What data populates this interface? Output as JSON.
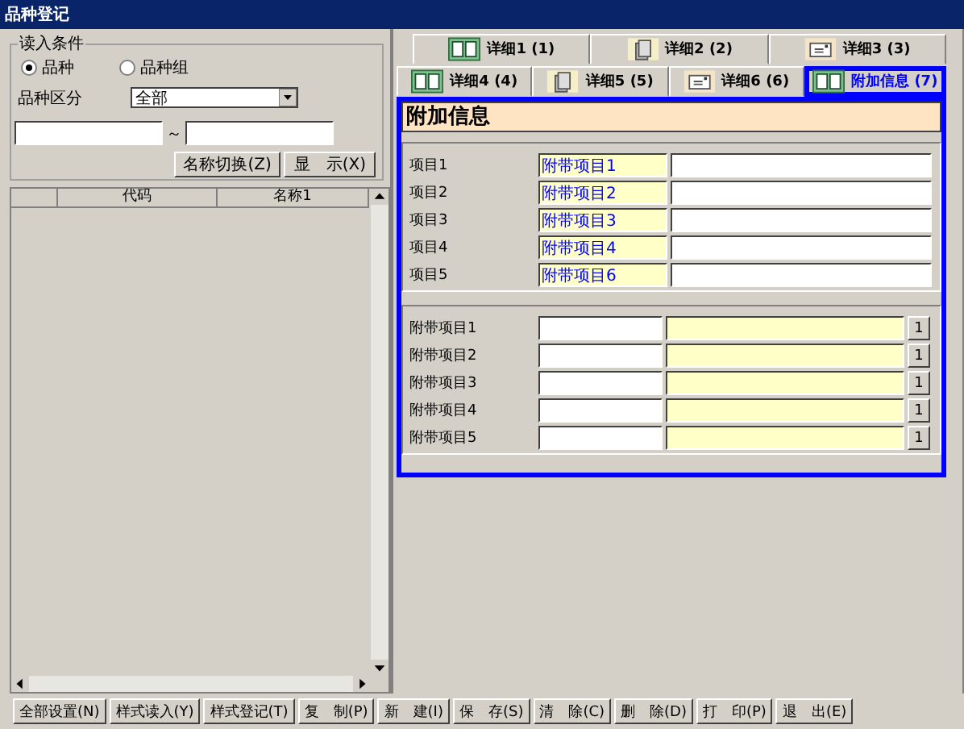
{
  "window": {
    "title": "品种登记"
  },
  "conditions": {
    "title": "读入条件",
    "radios": [
      {
        "label": "品种",
        "selected": true
      },
      {
        "label": "品种组",
        "selected": false
      }
    ],
    "category_label": "品种区分",
    "category_value": "全部",
    "range_separator": "～",
    "buttons": [
      "名称切换(Z)",
      "显　示(X)"
    ]
  },
  "grid": {
    "columns": [
      "代码",
      "名称1"
    ]
  },
  "tabs": [
    [
      {
        "label": "详细1 (1)",
        "kind": "book",
        "selected": false
      },
      {
        "label": "详细2 (2)",
        "kind": "document",
        "selected": false
      },
      {
        "label": "详细3 (3)",
        "kind": "card",
        "selected": false
      }
    ],
    [
      {
        "label": "详细4 (4)",
        "kind": "book",
        "selected": false
      },
      {
        "label": "详细5 (5)",
        "kind": "document",
        "selected": false
      },
      {
        "label": "详细6 (6)",
        "kind": "card",
        "selected": false
      },
      {
        "label": "附加信息 (7)",
        "kind": "book",
        "selected": true
      }
    ]
  ],
  "panel": {
    "title": "附加信息",
    "items": [
      {
        "label": "项目1",
        "value": "附带项目1"
      },
      {
        "label": "项目2",
        "value": "附带项目2"
      },
      {
        "label": "项目3",
        "value": "附带项目3"
      },
      {
        "label": "项目4",
        "value": "附带项目4"
      },
      {
        "label": "项目5",
        "value": "附带项目6"
      }
    ],
    "attached": [
      {
        "label": "附带项目1",
        "button": "1"
      },
      {
        "label": "附带项目2",
        "button": "1"
      },
      {
        "label": "附带项目3",
        "button": "1"
      },
      {
        "label": "附带项目4",
        "button": "1"
      },
      {
        "label": "附带项目5",
        "button": "1"
      }
    ]
  },
  "footer": [
    "全部设置(N)",
    "样式读入(Y)",
    "样式登记(T)",
    "复　制(P)",
    "新　建(I)",
    "保　存(S)",
    "清　除(C)",
    "删　除(D)",
    "打　印(P)",
    "退　出(E)"
  ]
}
